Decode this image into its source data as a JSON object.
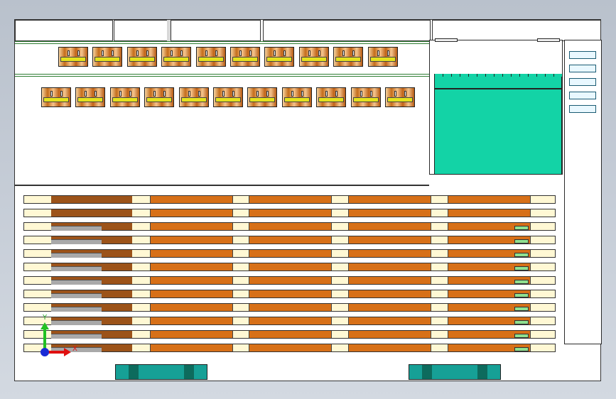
{
  "view": {
    "name": "assembly-top-view",
    "colors": {
      "background": "#c4cbd5",
      "copper": "#c56d1c",
      "band": "#e4e21e",
      "tank": "#13d3a6",
      "bar_orange": "#d77018",
      "bar_brown": "#9c5319",
      "bar_cream": "#fff8d4",
      "terminal": "#8fe08f",
      "footing": "#16a096"
    }
  },
  "components": {
    "upper_row_count": 10,
    "lower_row_count": 11
  },
  "busbars": {
    "row_count": 12,
    "rows_with_gray_insert": 10,
    "rows_with_green_terminal": 10
  },
  "side_panel": {
    "slot_count": 5
  },
  "axis_triad": {
    "x_label": "X",
    "y_label": "Y"
  }
}
